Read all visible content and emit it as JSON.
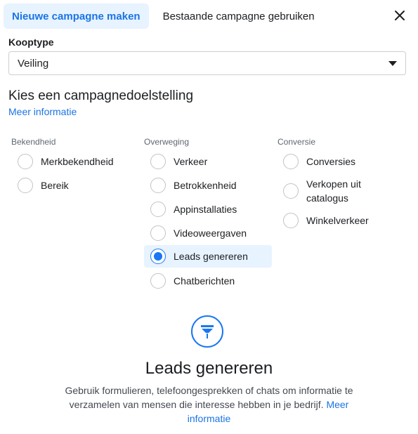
{
  "tabs": {
    "new_campaign": "Nieuwe campagne maken",
    "existing_campaign": "Bestaande campagne gebruiken"
  },
  "buying_type": {
    "label": "Kooptype",
    "value": "Veiling"
  },
  "objective": {
    "heading": "Kies een campagnedoelstelling",
    "more_info": "Meer informatie",
    "groups": [
      {
        "title": "Bekendheid",
        "options": [
          "Merkbekendheid",
          "Bereik"
        ]
      },
      {
        "title": "Overweging",
        "options": [
          "Verkeer",
          "Betrokkenheid",
          "Appinstallaties",
          "Videoweergaven",
          "Leads genereren",
          "Chatberichten"
        ]
      },
      {
        "title": "Conversie",
        "options": [
          "Conversies",
          "Verkopen uit catalogus",
          "Winkelverkeer"
        ]
      }
    ],
    "selected": "Leads genereren"
  },
  "detail": {
    "icon": "funnel-icon",
    "title": "Leads genereren",
    "description": "Gebruik formulieren, telefoongesprekken of chats om informatie te verzamelen van mensen die interesse hebben in je bedrijf.",
    "link": "Meer informatie"
  },
  "colors": {
    "accent": "#1877f2",
    "accent_bg": "#e7f3ff",
    "text": "#1c1e21",
    "muted": "#606770"
  }
}
